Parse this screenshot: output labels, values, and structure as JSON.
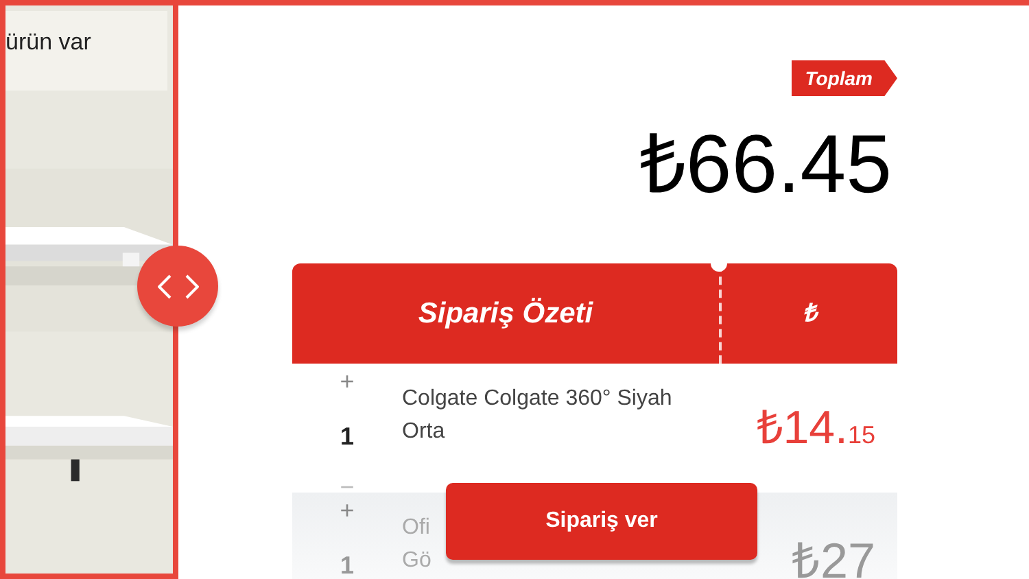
{
  "sidebar": {
    "banner": "ürün var"
  },
  "total": {
    "label": "Toplam",
    "amount": "₺66.45"
  },
  "summary": {
    "title": "Sipariş Özeti",
    "currency_column": "₺",
    "items": [
      {
        "plus": "+",
        "quantity": "1",
        "minus": "−",
        "name_lines": [
          "Colgate Colgate 360° Siyah",
          "Orta"
        ],
        "price_main": "₺14.",
        "price_cents": "15",
        "faded": false
      },
      {
        "plus": "+",
        "quantity": "1",
        "name_lines": [
          "Ofi",
          "Gö"
        ],
        "price_main": "₺27",
        "faded": true
      }
    ]
  },
  "order_button": "Sipariş ver"
}
